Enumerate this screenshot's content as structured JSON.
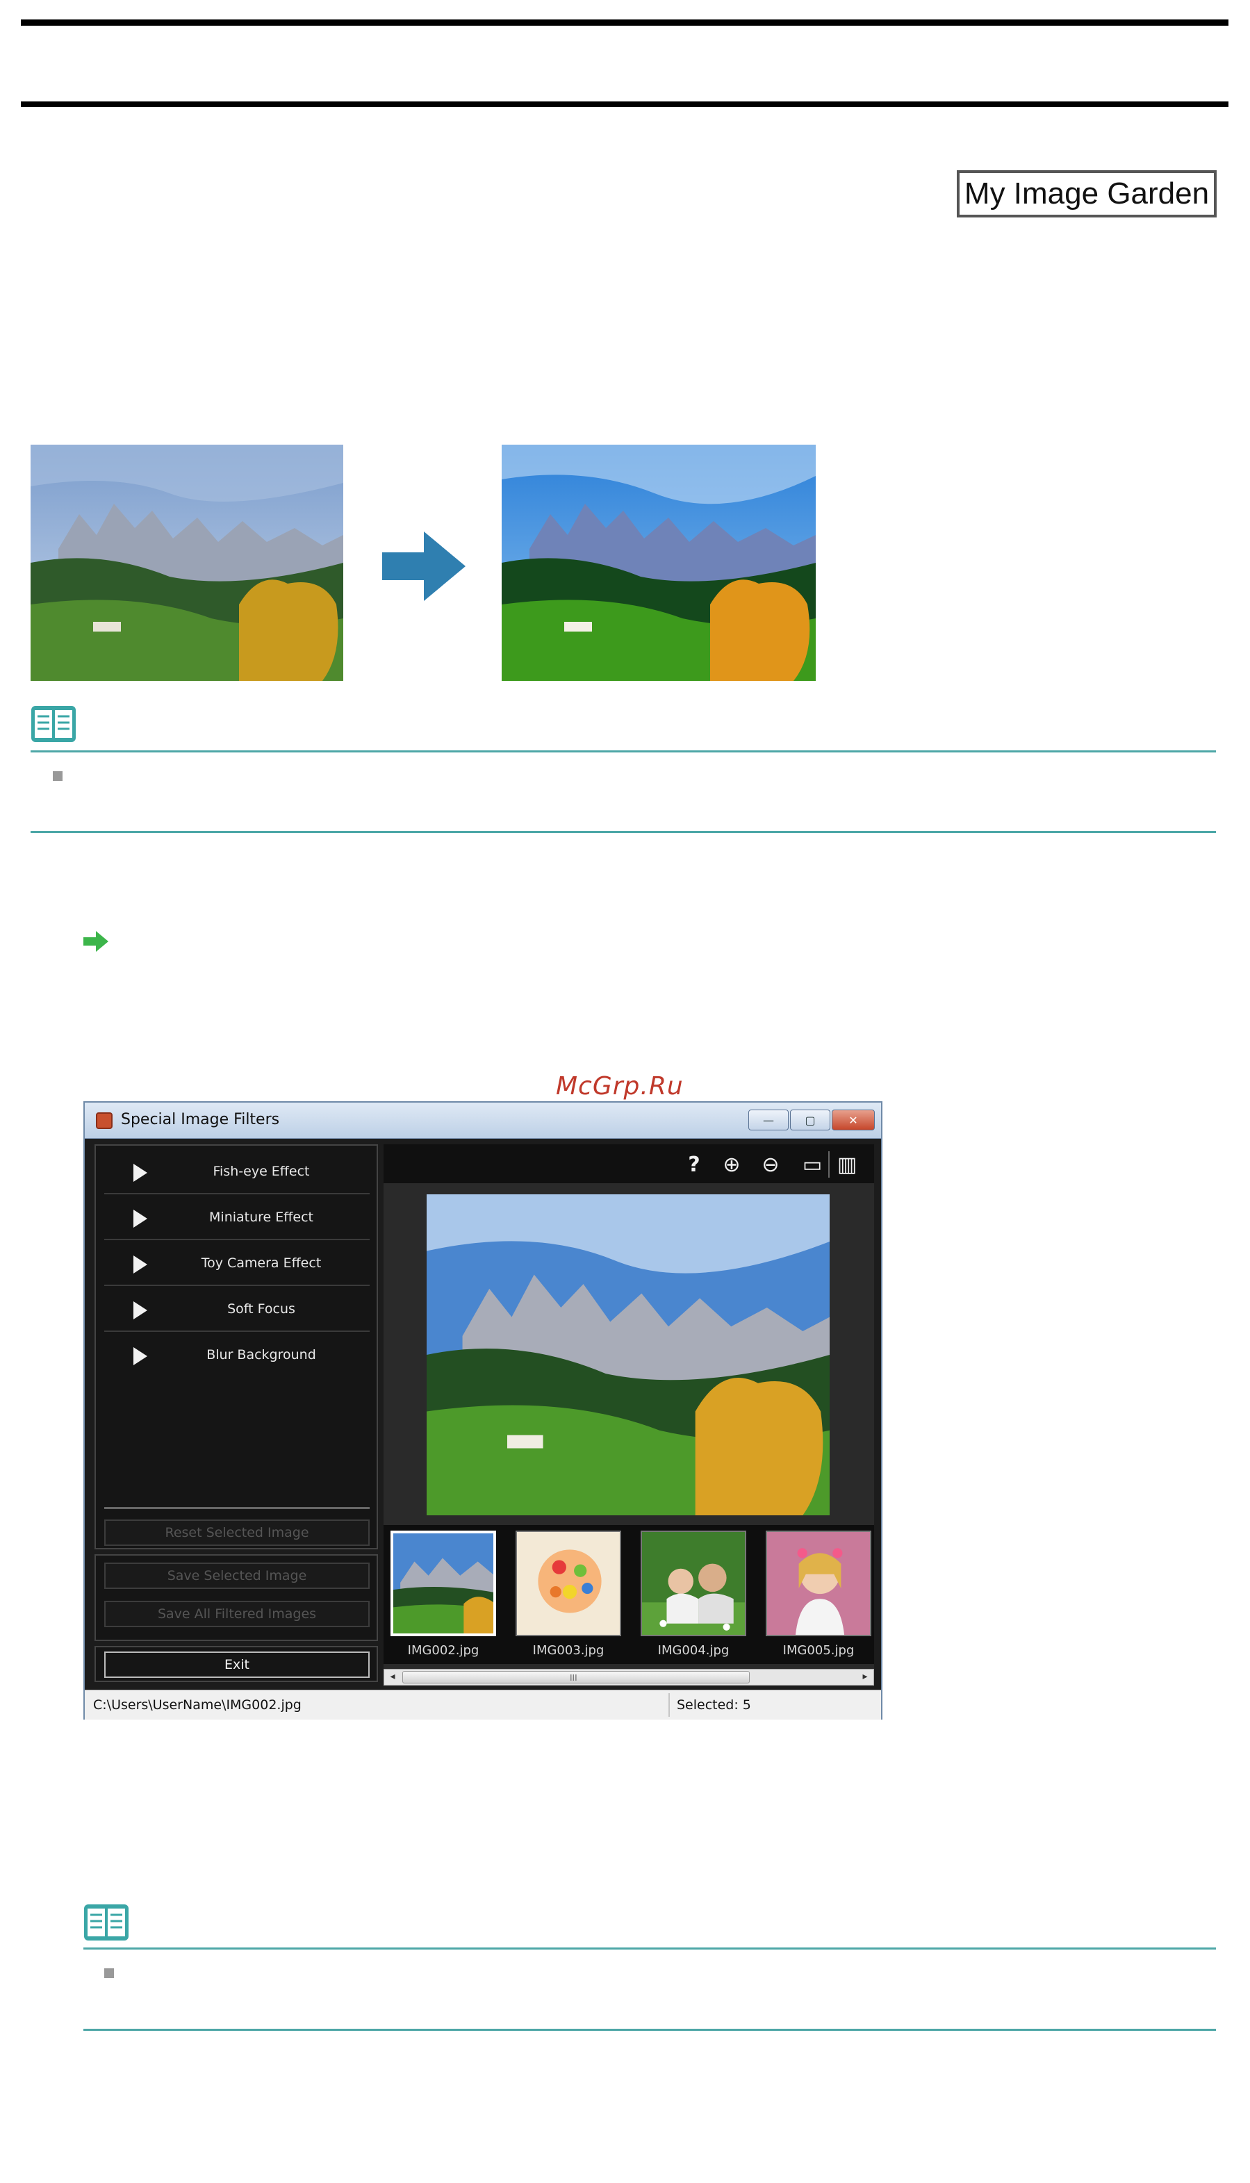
{
  "header": {
    "badge_label": "My Image Garden"
  },
  "watermark": "McGrp.Ru",
  "app": {
    "title": "Special Image Filters",
    "window_buttons": {
      "minimize": "—",
      "maximize": "▢",
      "close": "✕"
    },
    "effects": [
      {
        "label": "Fish-eye Effect"
      },
      {
        "label": "Miniature Effect"
      },
      {
        "label": "Toy Camera Effect"
      },
      {
        "label": "Soft Focus"
      },
      {
        "label": "Blur Background"
      }
    ],
    "buttons": {
      "reset": "Reset Selected Image",
      "save_selected": "Save Selected Image",
      "save_all": "Save All Filtered Images",
      "exit": "Exit"
    },
    "toolbar": {
      "help": "?",
      "zoom_in": "⊕",
      "zoom_out": "⊖",
      "fit": "▭",
      "compare": "▥"
    },
    "thumbnails": [
      {
        "name": "IMG002.jpg",
        "selected": true
      },
      {
        "name": "IMG003.jpg",
        "selected": false
      },
      {
        "name": "IMG004.jpg",
        "selected": false
      },
      {
        "name": "IMG005.jpg",
        "selected": false
      }
    ],
    "scrollbar": {
      "left": "◂",
      "right": "▸",
      "grip": "III"
    },
    "status": {
      "path": "C:\\Users\\UserName\\IMG002.jpg",
      "selected": "Selected: 5"
    }
  },
  "colors": {
    "teal_rule": "#4da7a7",
    "arrow_blue": "#2f7fb0",
    "green_arrow": "#3cb54a",
    "note_icon": "#3aa6a6"
  }
}
